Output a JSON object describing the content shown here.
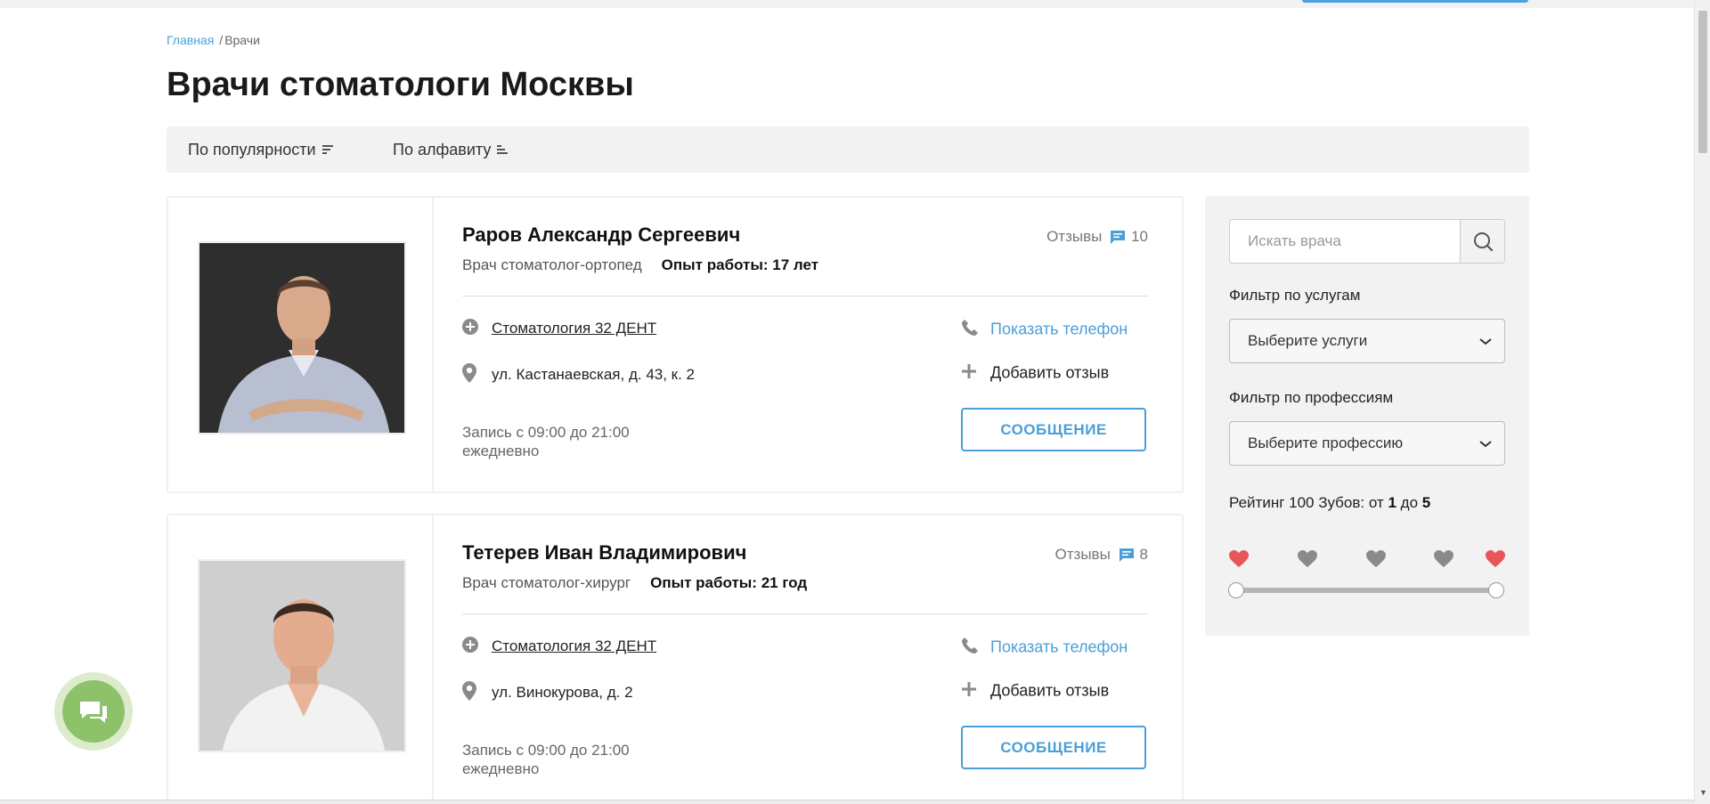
{
  "breadcrumb": {
    "home": "Главная",
    "separator": "/",
    "current": "Врачи"
  },
  "page_title": "Врачи стоматологи Москвы",
  "sort": {
    "popularity": "По популярности",
    "alphabet": "По алфавиту"
  },
  "doctors": [
    {
      "name": "Раров Александр Сергеевич",
      "specialty": "Врач стоматолог-ортопед",
      "experience": "Опыт работы: 17 лет",
      "reviews_label": "Отзывы",
      "reviews_count": "10",
      "clinic": "Стоматология 32 ДЕНТ",
      "address": "ул. Кастанаевская, д. 43, к. 2",
      "phone_label": "Показать телефон",
      "add_review_label": "Добавить отзыв",
      "schedule_line1": "Запись с 09:00 до 21:00",
      "schedule_line2": "ежедневно",
      "message_label": "СООБЩЕНИЕ"
    },
    {
      "name": "Тетерев Иван Владимирович",
      "specialty": "Врач стоматолог-хирург",
      "experience": "Опыт работы: 21 год",
      "reviews_label": "Отзывы",
      "reviews_count": "8",
      "clinic": "Стоматология 32 ДЕНТ",
      "address": "ул. Винокурова, д. 2",
      "phone_label": "Показать телефон",
      "add_review_label": "Добавить отзыв",
      "schedule_line1": "Запись с 09:00 до 21:00",
      "schedule_line2": "ежедневно",
      "message_label": "СООБЩЕНИЕ"
    }
  ],
  "sidebar": {
    "search_placeholder": "Искать врача",
    "services_label": "Фильтр по услугам",
    "services_select": "Выберите услуги",
    "profession_label": "Фильтр по профессиям",
    "profession_select": "Выберите профессию",
    "rating_prefix": "Рейтинг 100 Зубов: от",
    "rating_min": "1",
    "rating_mid": "до",
    "rating_max": "5"
  },
  "colors": {
    "accent": "#4a9fd8",
    "heart_active": "#e8555a",
    "heart_inactive": "#8a8a8a",
    "chat_green": "#8dc26a"
  },
  "icons": [
    "sort-icon",
    "comment-icon",
    "plus-circle-icon",
    "map-pin-icon",
    "phone-icon",
    "plus-icon",
    "search-icon",
    "chevron-down-icon",
    "heart-icon",
    "chat-icon"
  ]
}
